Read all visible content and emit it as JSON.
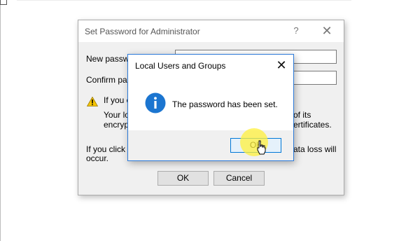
{
  "back_dialog": {
    "title": "Set Password for Administrator",
    "help_glyph": "?",
    "close_glyph": "✕",
    "new_password_label": "New passwo",
    "confirm_password_label": "Confirm pass",
    "warning_line1": "If you c",
    "warning_line2": "Your loc",
    "warning_line3": "encrypt",
    "warning_tail2": "of its",
    "warning_tail3": "ertificates.",
    "bottom_line1": "If you click C",
    "bottom_line2": "occur.",
    "bottom_tail1": "ata loss will",
    "ok_label": "OK",
    "cancel_label": "Cancel"
  },
  "message_box": {
    "title": "Local Users and Groups",
    "close_glyph": "✕",
    "message": "The password has been set.",
    "ok_label": "OK",
    "icon": "info-icon"
  },
  "colors": {
    "accent": "#0078d7",
    "info_icon": "#1b75d0",
    "warning_icon": "#f5c400",
    "click_highlight": "#fff03c"
  }
}
